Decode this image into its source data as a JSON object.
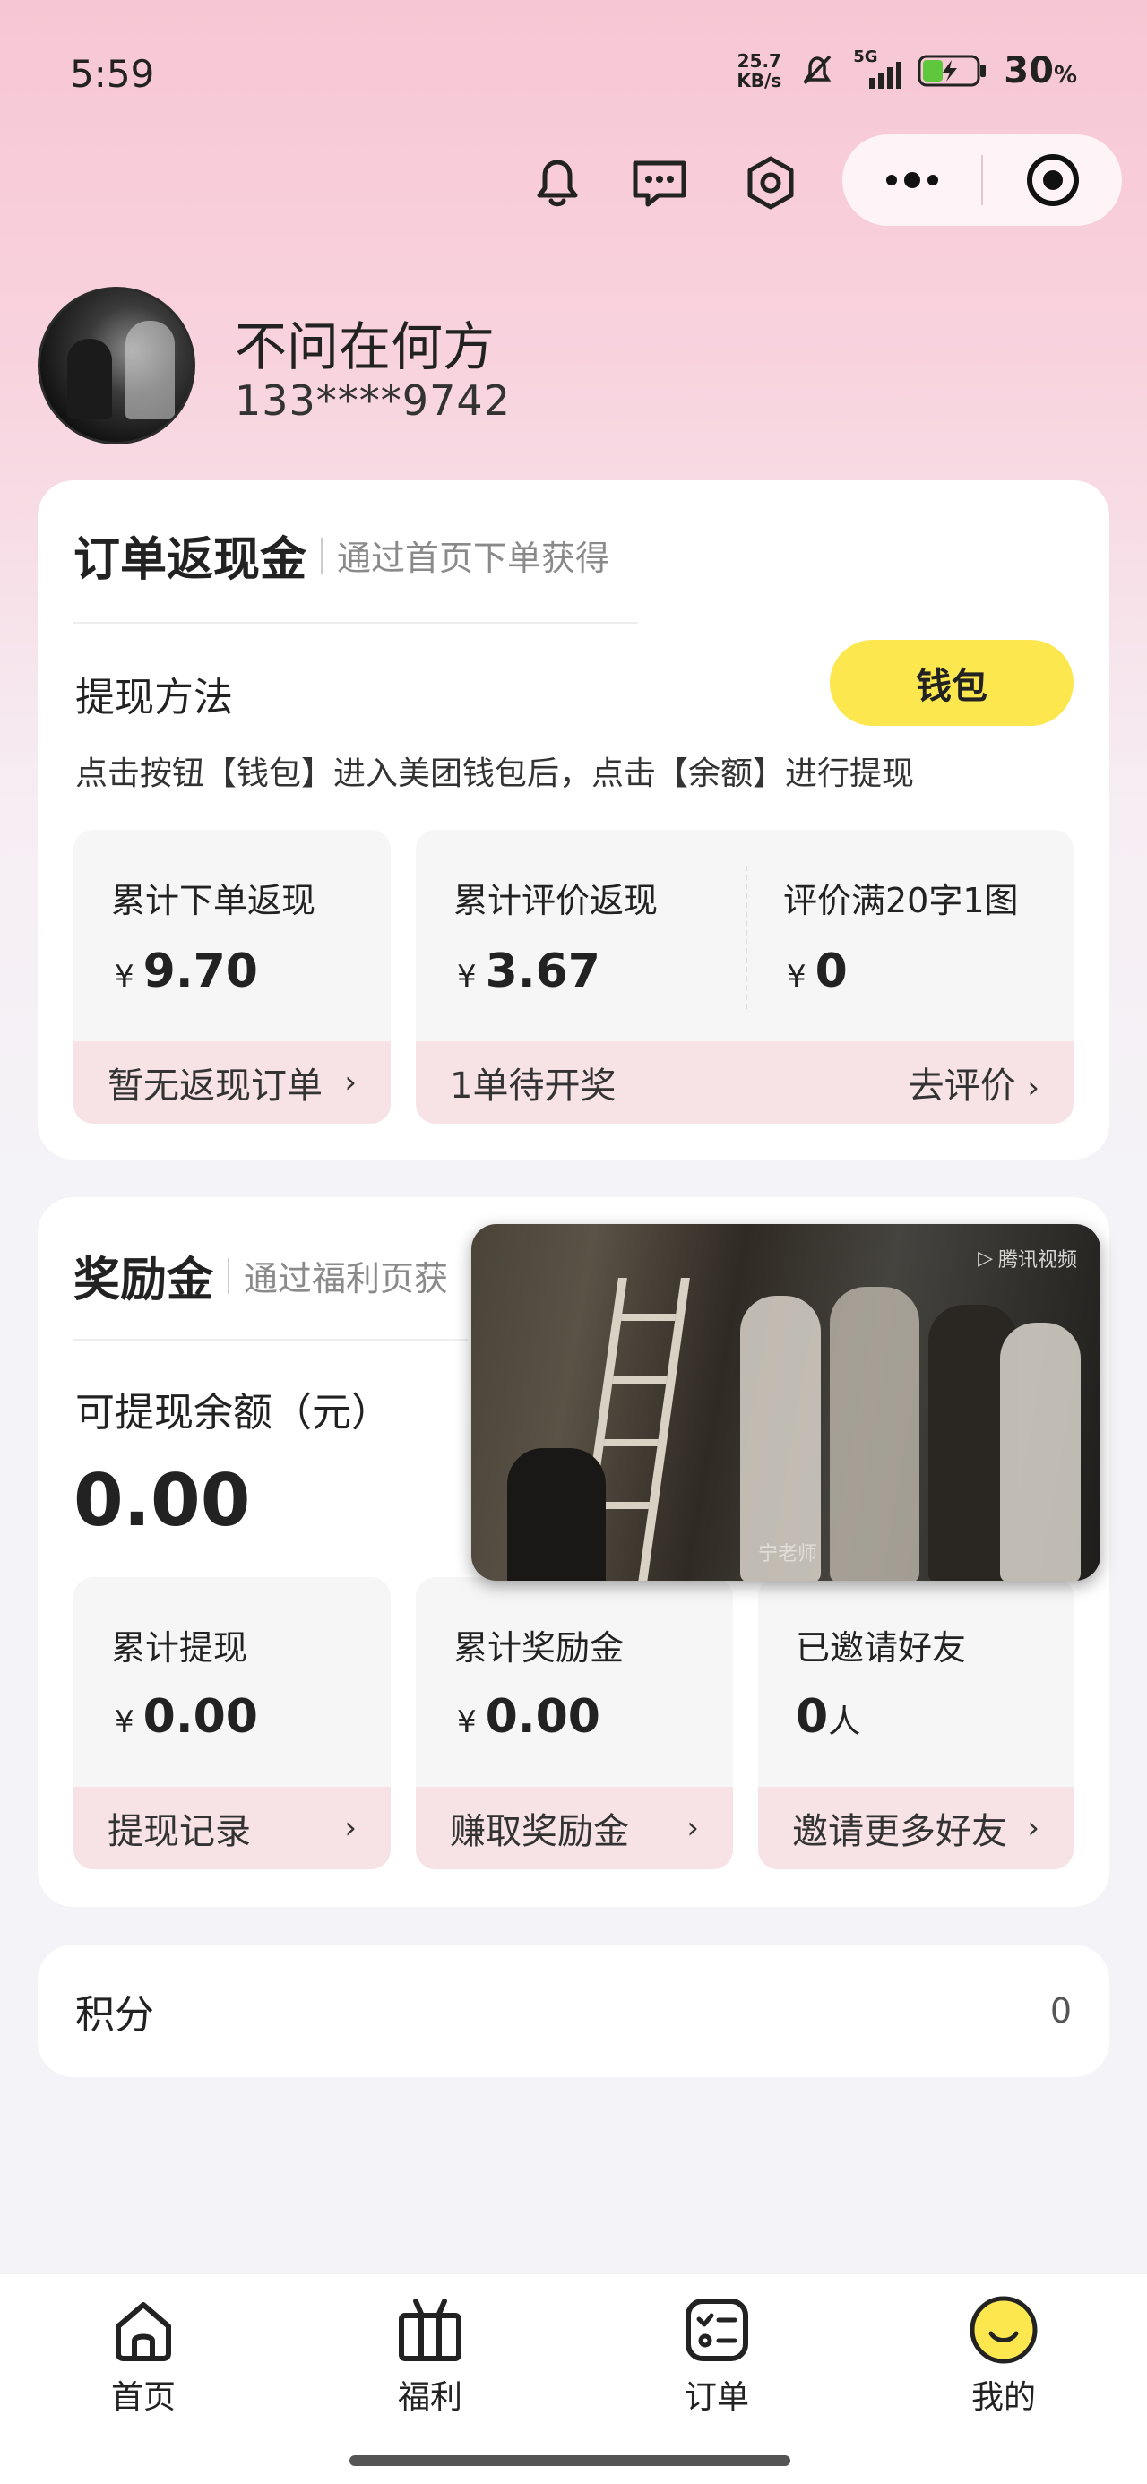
{
  "status_bar": {
    "time": "5:59",
    "net_speed_value": "25.7",
    "net_speed_unit": "KB/s",
    "network": "5G",
    "battery_pct": "30",
    "battery_pct_sign": "%"
  },
  "profile": {
    "nickname": "不问在何方",
    "phone": "133****9742"
  },
  "order_cashback": {
    "title": "订单返现金",
    "subtitle": "通过首页下单获得",
    "withdraw_heading": "提现方法",
    "wallet_button": "钱包",
    "instructions": "点击按钮【钱包】进入美团钱包后，点击【余额】进行提现",
    "stats": [
      {
        "label": "累计下单返现",
        "currency": "¥",
        "value": "9.70",
        "footer": "暂无返现订单"
      },
      {
        "label": "累计评价返现",
        "currency": "¥",
        "value": "3.67"
      },
      {
        "label": "评价满20字1图",
        "currency": "¥",
        "value": "0"
      }
    ],
    "review_footer_left": "1单待开奖",
    "review_footer_right": "去评价"
  },
  "rewards": {
    "title": "奖励金",
    "subtitle": "通过福利页获",
    "balance_label": "可提现余额（元）",
    "balance_value": "0.00",
    "stats": [
      {
        "label": "累计提现",
        "currency": "¥",
        "value": "0.00",
        "footer": "提现记录"
      },
      {
        "label": "累计奖励金",
        "currency": "¥",
        "value": "0.00",
        "footer": "赚取奖励金"
      },
      {
        "label": "已邀请好友",
        "value": "0",
        "unit": "人",
        "footer": "邀请更多好友"
      }
    ]
  },
  "video_overlay": {
    "logo": "腾讯视频",
    "watermark": "宁老师"
  },
  "points": {
    "label": "积分",
    "value": "0"
  },
  "bottom_nav": [
    {
      "label": "首页",
      "icon": "home-icon"
    },
    {
      "label": "福利",
      "icon": "gift-icon"
    },
    {
      "label": "订单",
      "icon": "order-list-icon"
    },
    {
      "label": "我的",
      "icon": "smiley-icon"
    }
  ],
  "colors": {
    "accent_yellow": "#fce74f",
    "footer_pink": "#f7e3e5",
    "header_pink": "#f7c6d4"
  }
}
